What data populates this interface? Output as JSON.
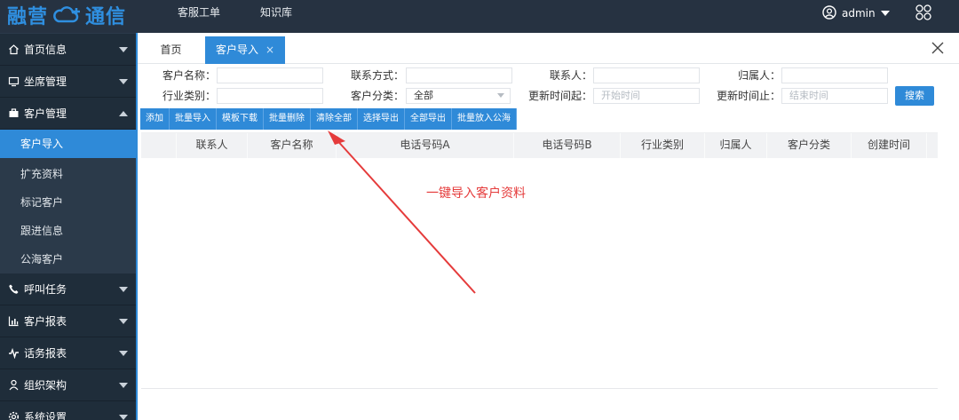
{
  "app": {
    "logo_text_left": "融营",
    "logo_text_right": "通信",
    "brand_color": "#2f8fe0"
  },
  "topnav": [
    "客服工单",
    "知识库"
  ],
  "user": {
    "name": "admin",
    "icon": "user-circle-icon"
  },
  "sidebar": {
    "groups": [
      {
        "label": "首页信息",
        "icon": "home-icon",
        "expanded": false
      },
      {
        "label": "坐席管理",
        "icon": "monitor-icon",
        "expanded": false
      },
      {
        "label": "客户管理",
        "icon": "briefcase-icon",
        "expanded": true
      },
      {
        "label": "呼叫任务",
        "icon": "phone-icon",
        "expanded": false
      },
      {
        "label": "客户报表",
        "icon": "bar-chart-icon",
        "expanded": false
      },
      {
        "label": "话务报表",
        "icon": "activity-icon",
        "expanded": false
      },
      {
        "label": "组织架构",
        "icon": "org-icon",
        "expanded": false
      },
      {
        "label": "系统设置",
        "icon": "settings-icon",
        "expanded": false
      }
    ],
    "sub_items": [
      {
        "label": "客户导入",
        "active": true
      },
      {
        "label": "扩充资料",
        "active": false
      },
      {
        "label": "标记客户",
        "active": false
      },
      {
        "label": "跟进信息",
        "active": false
      },
      {
        "label": "公海客户",
        "active": false
      }
    ]
  },
  "tabs": {
    "home": "首页",
    "active": "客户导入",
    "active_close": "×"
  },
  "filters": {
    "customer_name_label": "客户名称：",
    "contact_method_label": "联系方式：",
    "contact_person_label": "联系人：",
    "owner_label": "归属人：",
    "industry_label": "行业类别：",
    "category_label": "客户分类：",
    "category_value": "全部",
    "update_start_label": "更新时间起：",
    "update_start_placeholder": "开始时间",
    "update_end_label": "更新时间止：",
    "update_end_placeholder": "结束时间",
    "search_button": "搜索"
  },
  "toolbar": [
    "添加",
    "批量导入",
    "模板下载",
    "批量删除",
    "清除全部",
    "选择导出",
    "全部导出",
    "批量放入公海"
  ],
  "table": {
    "columns": [
      "联系人",
      "客户名称",
      "电话号码A",
      "电话号码B",
      "行业类别",
      "归属人",
      "客户分类",
      "创建时间"
    ],
    "rows": []
  },
  "annotation": {
    "text": "一键导入客户资料",
    "color": "#e53b3b"
  }
}
